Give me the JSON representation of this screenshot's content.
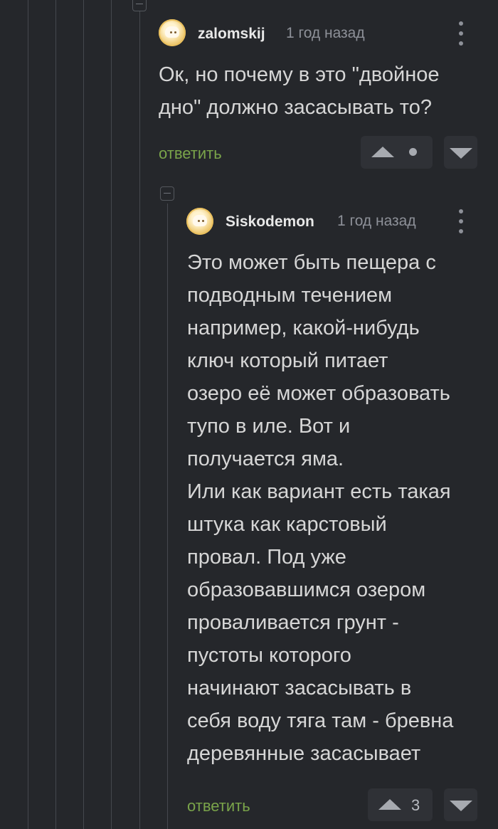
{
  "comments": [
    {
      "username": "zalomskij",
      "time": "1 год назад",
      "text_lines": [
        "Ок, но почему в это \"двойное",
        "дно\" должно засасывать то?"
      ],
      "reply": "ответить",
      "rating": ""
    },
    {
      "username": "Siskodemon",
      "time": "1 год назад",
      "text_lines": [
        "Это может быть пещера с",
        "подводным течением",
        "например, какой-нибудь",
        "ключ который питает",
        "озеро её может образовать",
        "тупо в иле. Вот и",
        "получается яма.",
        "Или как вариант есть такая",
        "штука как карстовый",
        "провал. Под уже",
        "образовавшимся озером",
        "проваливается грунт -",
        "пустоты которого",
        "начинают засасывать в",
        "себя воду тяга там - бревна",
        "деревянные засасывает"
      ],
      "reply": "ответить",
      "rating": "3"
    }
  ],
  "icons": {
    "collapse": "collapse-minus-icon",
    "more": "kebab-menu-icon",
    "upvote": "upvote-arrow-icon",
    "downvote": "downvote-arrow-icon"
  },
  "colors": {
    "background": "#25272b",
    "thread_line": "#45484e",
    "reply_link": "#7aa44a",
    "username": "#e8e8e8",
    "timestamp": "#8d9098"
  }
}
